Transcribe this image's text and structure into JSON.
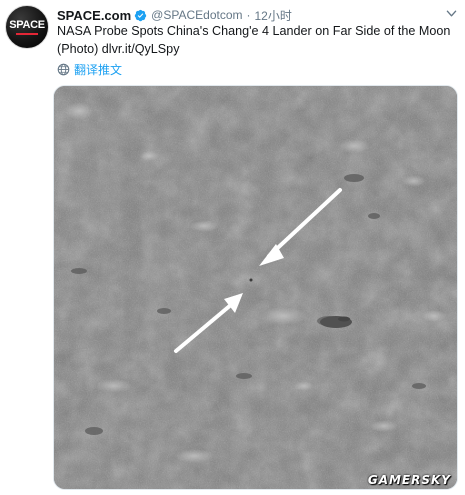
{
  "account": {
    "name": "SPACE.com",
    "handle": "@SPACEdotcom",
    "separator": "·",
    "time": "12小时",
    "avatar_text": "SPACE"
  },
  "tweet": {
    "text": "NASA Probe Spots China's Chang'e 4 Lander on Far Side of the Moon (Photo) dlvr.it/QyLSpy",
    "translate_label": "翻译推文"
  },
  "photo": {
    "watermark": "GAMERSKY"
  },
  "colors": {
    "link": "#1da1f2",
    "secondary_text": "#657786",
    "verified_badge": "#1da1f2"
  },
  "icons": {
    "verified": "verified-badge-icon",
    "caret": "chevron-down-icon",
    "translate": "globe-icon"
  }
}
